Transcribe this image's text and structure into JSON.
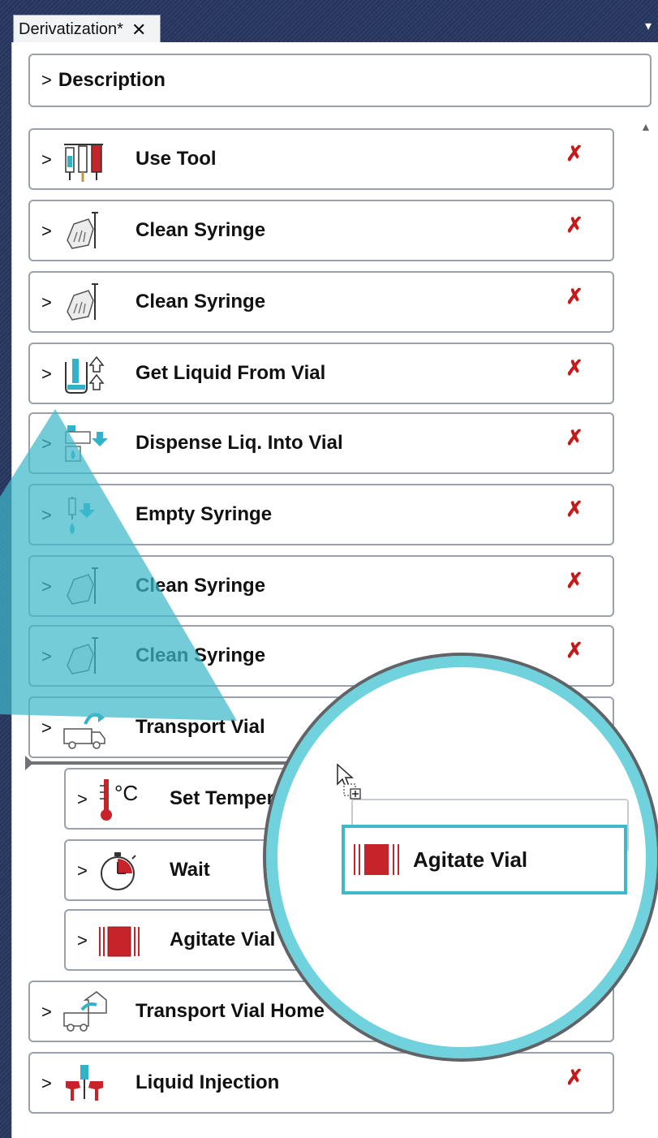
{
  "tab": {
    "title": "Derivatization*",
    "close": "✕"
  },
  "description": {
    "label": "Description",
    "chevron": ">"
  },
  "steps": [
    {
      "label": "Use Tool",
      "icon": "use-tool-icon"
    },
    {
      "label": "Clean Syringe",
      "icon": "clean-syringe-icon"
    },
    {
      "label": "Clean Syringe",
      "icon": "clean-syringe-icon"
    },
    {
      "label": "Get Liquid From Vial",
      "icon": "get-liquid-icon"
    },
    {
      "label": "Dispense Liq. Into Vial",
      "icon": "dispense-liquid-icon"
    },
    {
      "label": "Empty Syringe",
      "icon": "empty-syringe-icon"
    },
    {
      "label": "Clean Syringe",
      "icon": "clean-syringe-icon"
    },
    {
      "label": "Clean Syringe",
      "icon": "clean-syringe-icon"
    },
    {
      "label": "Transport Vial",
      "icon": "transport-vial-icon"
    }
  ],
  "nested_steps": [
    {
      "label": "Set Temperature",
      "icon": "thermometer-icon",
      "unit": "°C"
    },
    {
      "label": "Wait",
      "icon": "stopwatch-icon"
    },
    {
      "label": "Agitate Vial",
      "icon": "agitate-vial-icon"
    }
  ],
  "after_steps": [
    {
      "label": "Transport Vial Home",
      "icon": "transport-home-icon"
    },
    {
      "label": "Liquid Injection",
      "icon": "injection-icon"
    }
  ],
  "drag_item": {
    "label": "Agitate Vial",
    "icon": "agitate-vial-icon"
  },
  "glyphs": {
    "chevron": ">",
    "delete": "✗",
    "scroll_up": "▲",
    "menu": "▾"
  },
  "colors": {
    "accent": "#3fb8c9",
    "delete": "#c51a1a",
    "frame": "#2f3f69"
  }
}
